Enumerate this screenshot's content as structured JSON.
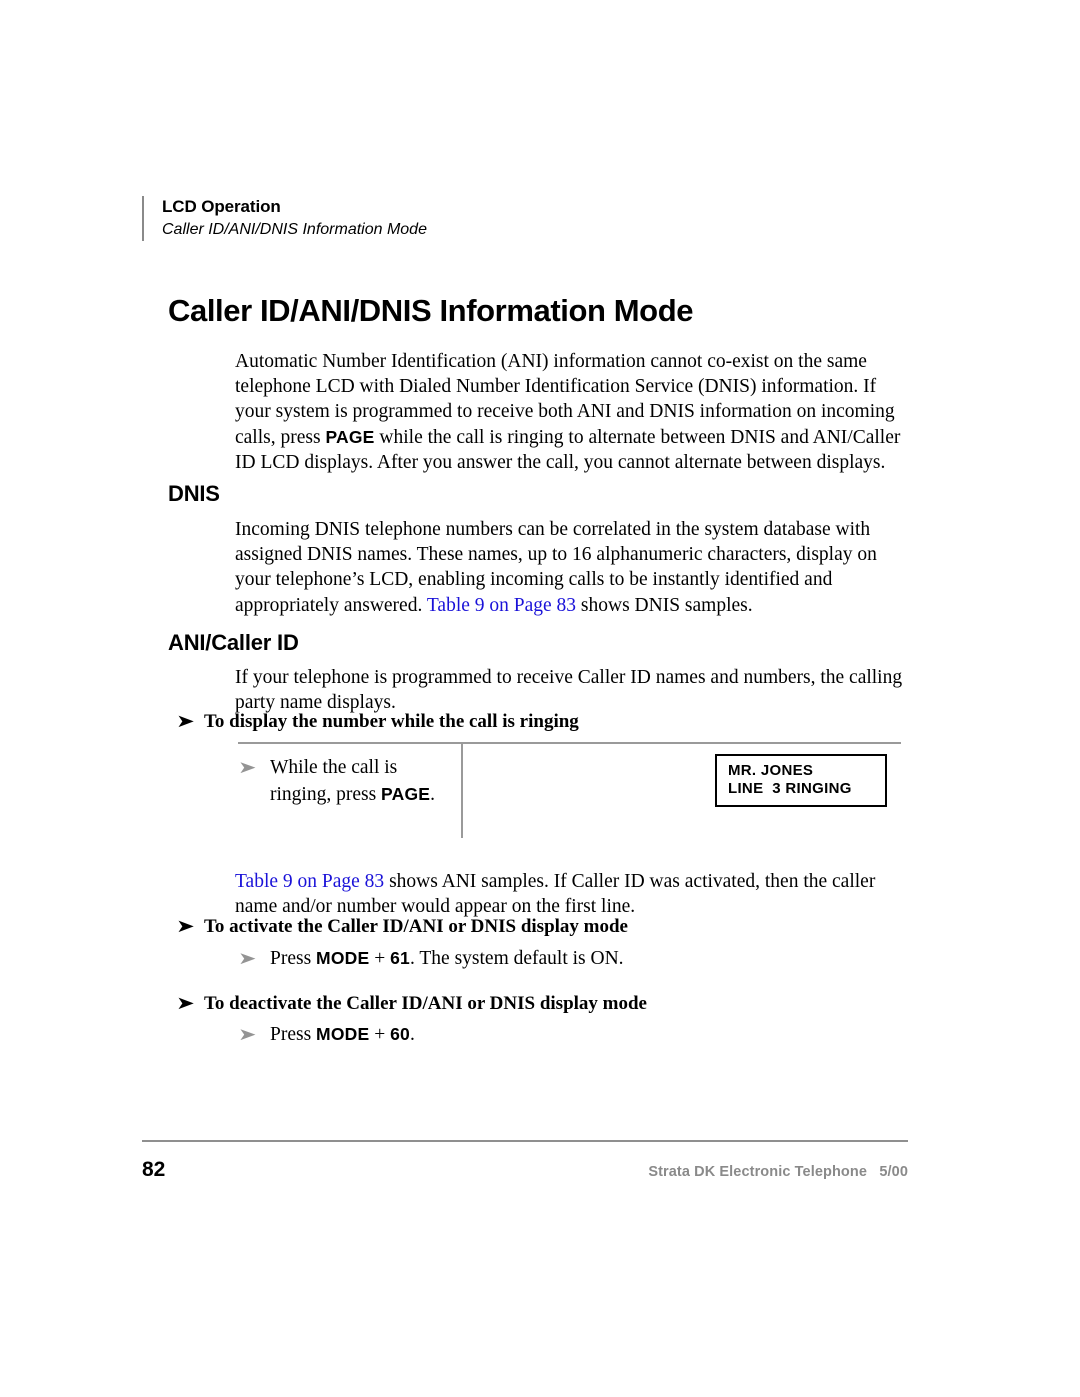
{
  "header": {
    "title": "LCD Operation",
    "subtitle": "Caller ID/ANI/DNIS Information Mode"
  },
  "chapter_title": "Caller ID/ANI/DNIS Information Mode",
  "intro": {
    "part1": "Automatic Number Identification (ANI) information cannot co-exist on the same telephone LCD with Dialed Number Identification Service (DNIS) information. If your system is programmed to receive both ANI and DNIS information on incoming calls, press ",
    "key": "PAGE",
    "part2": " while the call is ringing to alternate between DNIS and ANI/Caller ID LCD displays. After you answer the call, you cannot alternate between displays."
  },
  "dnis": {
    "heading": "DNIS",
    "part1": "Incoming DNIS telephone numbers can be correlated in the system database with assigned DNIS names. These names, up to 16 alphanumeric characters, display on your telephone’s LCD, enabling incoming calls to be instantly identified and appropriately answered. ",
    "xref": "Table 9 on Page 83",
    "part2": " shows DNIS samples."
  },
  "ani": {
    "heading": "ANI/Caller ID",
    "paragraph": "If your telephone is programmed to receive Caller ID names and numbers, the calling party name displays."
  },
  "procedure_display_number": {
    "arrow": "➤",
    "heading": "To display the number while the call is ringing",
    "step": {
      "arrow": "➤",
      "part1": "While the call is ringing, press ",
      "key": "PAGE",
      "part2": "."
    },
    "lcd_sample": {
      "line1": "MR. JONES",
      "line2": "LINE  3 RINGING"
    }
  },
  "after_table": {
    "xref": "Table 9 on Page 83",
    "text": " shows ANI samples. If Caller ID was activated, then the caller name and/or number would appear on the first line."
  },
  "procedure_activate": {
    "arrow": "➤",
    "heading": "To activate the Caller ID/ANI or DNIS display mode",
    "step": {
      "arrow": "➤",
      "part1": "Press ",
      "key1": "MODE",
      "plus": " + ",
      "key2": "61",
      "part2": ". The system default is ON."
    }
  },
  "procedure_deactivate": {
    "arrow": "➤",
    "heading": "To deactivate the Caller ID/ANI or DNIS display mode",
    "step": {
      "arrow": "➤",
      "part1": "Press ",
      "key1": "MODE",
      "plus": " + ",
      "key2": "60",
      "part2": "."
    }
  },
  "footer": {
    "page_number": "82",
    "doc_info": "Strata DK Electronic Telephone   5/00"
  },
  "colors": {
    "xref_link": "#1a12d8",
    "rule_gray": "#8f8f8f",
    "step_arrow_gray": "#949494",
    "footer_text_gray": "#8a8a8a"
  }
}
